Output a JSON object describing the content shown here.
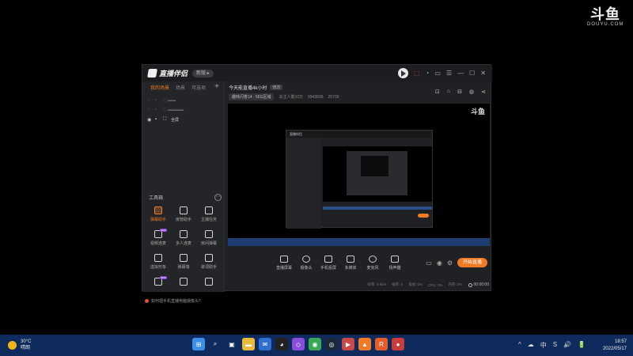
{
  "corner_logo": {
    "mark": "斗鱼",
    "sub": "DOUYU.COM"
  },
  "app": {
    "name": "直播伴侣",
    "version_badge": "新版 ▸",
    "scene_tabs": [
      "我的场景",
      "场景",
      "可选项"
    ],
    "sources": [
      {
        "label": "全屏"
      }
    ],
    "tools_title": "工具箱",
    "tools": [
      {
        "label": "弹幕助手",
        "highlight": true
      },
      {
        "label": "房管助手"
      },
      {
        "label": "主播任务"
      },
      {
        "label": "视频连麦",
        "tag": "NEW"
      },
      {
        "label": "多人连麦"
      },
      {
        "label": "房间弹幕"
      },
      {
        "label": "虚拟形象"
      },
      {
        "label": "弹幕墙"
      },
      {
        "label": "歌词助手"
      },
      {
        "label": "",
        "tag": "NEW"
      },
      {
        "label": ""
      },
      {
        "label": ""
      }
    ],
    "tip": "如何把手机直播电脑摄像头?",
    "room": {
      "title": "今天能直播4k小时",
      "edit_label": "修改",
      "category": "趣味闪答14 · 56G区域",
      "stats": [
        "关注人数10万",
        "9943695",
        "26709"
      ]
    },
    "preview_watermark": "斗鱼",
    "toolbar": {
      "buttons": [
        "直播屏幕",
        "摄像头",
        "手机投屏",
        "多媒体",
        "麦克风",
        "扬声器"
      ],
      "go_live": "开始直播"
    },
    "status": {
      "items": [
        "码率: 0 kb/s",
        "帧率: 0",
        "丢帧: 0%",
        "CPU: 0%",
        "内存: 0%"
      ],
      "timer": "00:00:00"
    }
  },
  "taskbar": {
    "weather_temp": "30°C",
    "weather_desc": "晴朗",
    "time": "18:57",
    "date": "2022/05/17",
    "tray": [
      "^",
      "☁",
      "中",
      "S",
      "🔊",
      "🔋"
    ],
    "apps": [
      {
        "name": "start-icon",
        "glyph": "⊞",
        "color": "#3d8ee6"
      },
      {
        "name": "search-icon",
        "glyph": "⌕",
        "color": "transparent"
      },
      {
        "name": "taskview-icon",
        "glyph": "▣",
        "color": "transparent"
      },
      {
        "name": "explorer-icon",
        "glyph": "▬",
        "color": "#e8b93b"
      },
      {
        "name": "mail-icon",
        "glyph": "✉",
        "color": "#2f6fd0"
      },
      {
        "name": "qq-icon",
        "glyph": "◕",
        "color": "#222"
      },
      {
        "name": "vs-icon",
        "glyph": "◇",
        "color": "#8a4fd9"
      },
      {
        "name": "chrome-icon",
        "glyph": "◉",
        "color": "#3aa757"
      },
      {
        "name": "steam-icon",
        "glyph": "◎",
        "color": "#1b2838"
      },
      {
        "name": "app-icon",
        "glyph": "▶",
        "color": "#c94848"
      },
      {
        "name": "douyu-icon",
        "glyph": "▲",
        "color": "#f07b24"
      },
      {
        "name": "rct-icon",
        "glyph": "R",
        "color": "#e85c2c"
      },
      {
        "name": "record-icon",
        "glyph": "●",
        "color": "#c93d3d"
      }
    ]
  }
}
